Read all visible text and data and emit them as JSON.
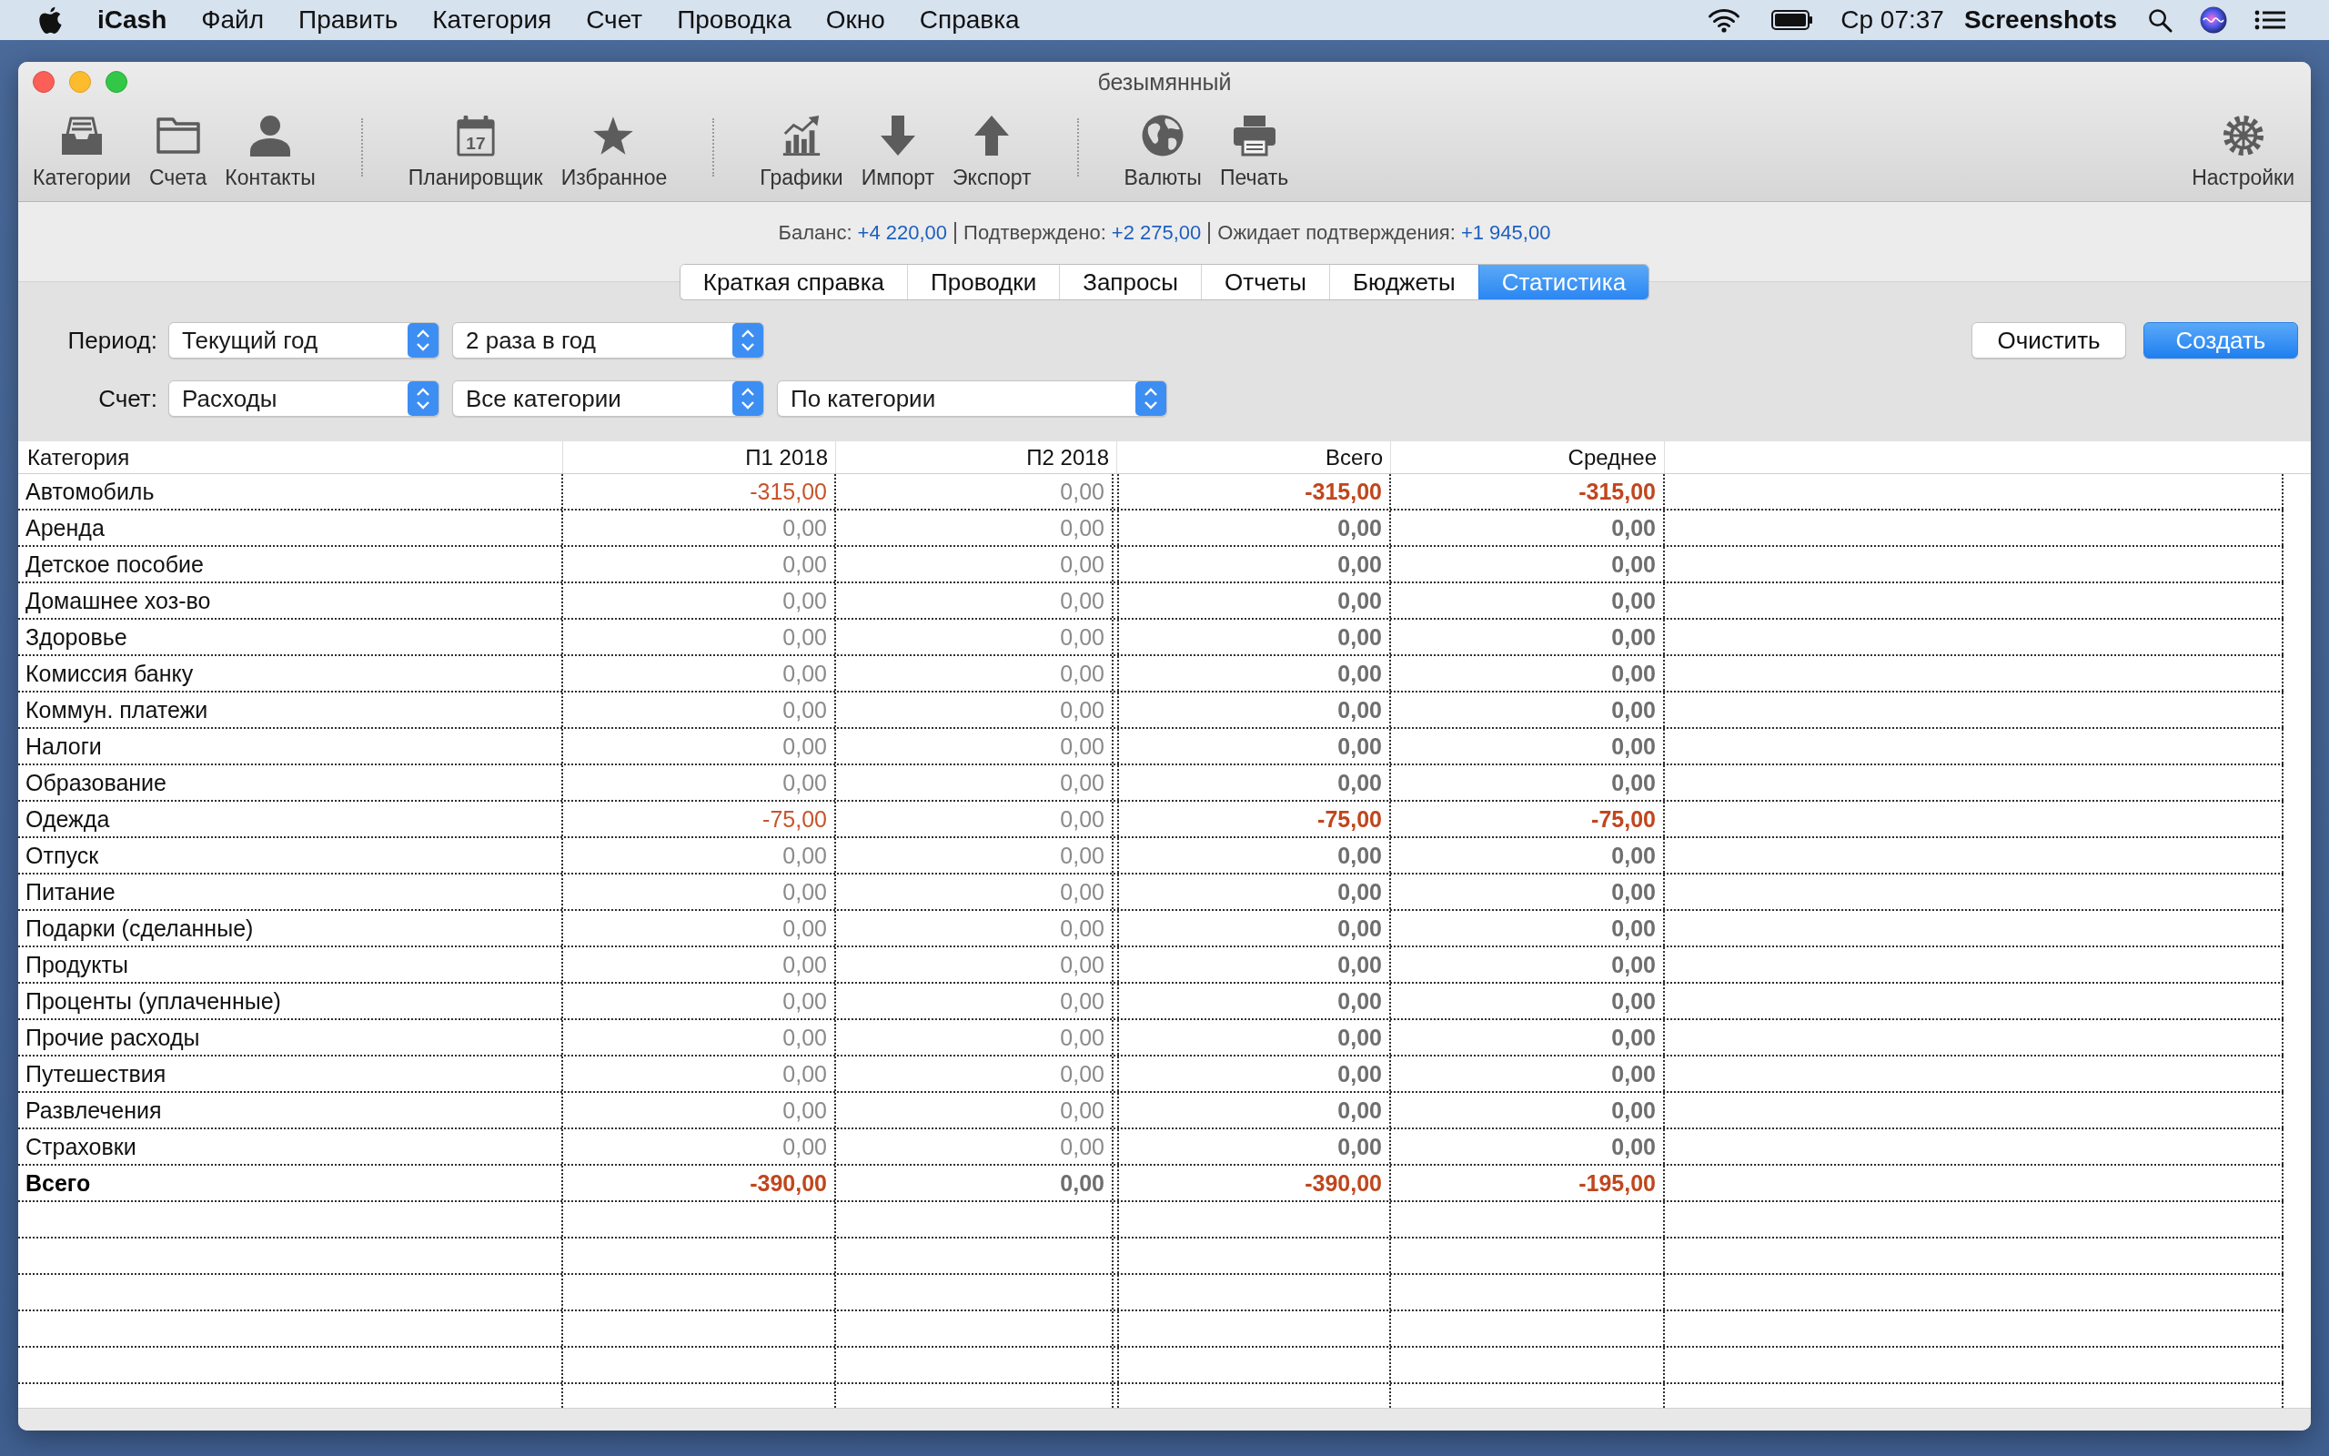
{
  "menu_bar": {
    "app": "iCash",
    "menus": [
      "Файл",
      "Править",
      "Категория",
      "Счет",
      "Проводка",
      "Окно",
      "Справка"
    ],
    "clock": "Ср 07:37",
    "user": "Screenshots"
  },
  "window": {
    "title": "безымянный"
  },
  "toolbar": {
    "groups": [
      [
        {
          "kind": "categories",
          "label": "Категории"
        },
        {
          "kind": "accounts",
          "label": "Счета"
        },
        {
          "kind": "contacts",
          "label": "Контакты"
        }
      ],
      [
        {
          "kind": "scheduler",
          "label": "Планировщик",
          "day": "17"
        },
        {
          "kind": "favorites",
          "label": "Избранное"
        }
      ],
      [
        {
          "kind": "charts",
          "label": "Графики"
        },
        {
          "kind": "import",
          "label": "Импорт"
        },
        {
          "kind": "export",
          "label": "Экспорт"
        }
      ],
      [
        {
          "kind": "currencies",
          "label": "Валюты"
        },
        {
          "kind": "print",
          "label": "Печать"
        }
      ]
    ],
    "trailing": [
      {
        "kind": "settings",
        "label": "Настройки"
      }
    ]
  },
  "summary": [
    {
      "label": "Баланс:",
      "value": "+4 220,00"
    },
    {
      "label": "Подтверждено:",
      "value": "+2 275,00"
    },
    {
      "label": "Ожидает подтверждения:",
      "value": "+1 945,00"
    }
  ],
  "tabs": [
    {
      "label": "Краткая справка",
      "selected": false
    },
    {
      "label": "Проводки",
      "selected": false
    },
    {
      "label": "Запросы",
      "selected": false
    },
    {
      "label": "Отчеты",
      "selected": false
    },
    {
      "label": "Бюджеты",
      "selected": false
    },
    {
      "label": "Статистика",
      "selected": true
    }
  ],
  "filters": [
    {
      "label": "Период:",
      "popups": [
        "Текущий год",
        "2 раза в год"
      ]
    },
    {
      "label": "Счет:",
      "popups": [
        "Расходы",
        "Все категории",
        "По категории"
      ]
    }
  ],
  "buttons": [
    {
      "label": "Очистить",
      "primary": false
    },
    {
      "label": "Создать",
      "primary": true
    }
  ],
  "table": {
    "columns": [
      {
        "label": "Категория",
        "kind": "name"
      },
      {
        "label": "П1 2018",
        "kind": "period"
      },
      {
        "label": "П2 2018",
        "kind": "period"
      },
      {
        "label": "Всего",
        "kind": "summary"
      },
      {
        "label": "Среднее",
        "kind": "summary"
      }
    ],
    "rows": [
      {
        "kind": "category",
        "cells": [
          {
            "value": "Автомобиль"
          },
          {
            "value": "-315,00",
            "negative": true
          },
          {
            "value": "0,00",
            "negative": false
          },
          {
            "value": "-315,00",
            "negative": true
          },
          {
            "value": "-315,00",
            "negative": true
          }
        ]
      },
      {
        "kind": "category",
        "cells": [
          {
            "value": "Аренда"
          },
          {
            "value": "0,00",
            "negative": false
          },
          {
            "value": "0,00",
            "negative": false
          },
          {
            "value": "0,00",
            "negative": false
          },
          {
            "value": "0,00",
            "negative": false
          }
        ]
      },
      {
        "kind": "category",
        "cells": [
          {
            "value": "Детское пособие"
          },
          {
            "value": "0,00",
            "negative": false
          },
          {
            "value": "0,00",
            "negative": false
          },
          {
            "value": "0,00",
            "negative": false
          },
          {
            "value": "0,00",
            "negative": false
          }
        ]
      },
      {
        "kind": "category",
        "cells": [
          {
            "value": "Домашнее хоз-во"
          },
          {
            "value": "0,00",
            "negative": false
          },
          {
            "value": "0,00",
            "negative": false
          },
          {
            "value": "0,00",
            "negative": false
          },
          {
            "value": "0,00",
            "negative": false
          }
        ]
      },
      {
        "kind": "category",
        "cells": [
          {
            "value": "Здоровье"
          },
          {
            "value": "0,00",
            "negative": false
          },
          {
            "value": "0,00",
            "negative": false
          },
          {
            "value": "0,00",
            "negative": false
          },
          {
            "value": "0,00",
            "negative": false
          }
        ]
      },
      {
        "kind": "category",
        "cells": [
          {
            "value": "Комиссия банку"
          },
          {
            "value": "0,00",
            "negative": false
          },
          {
            "value": "0,00",
            "negative": false
          },
          {
            "value": "0,00",
            "negative": false
          },
          {
            "value": "0,00",
            "negative": false
          }
        ]
      },
      {
        "kind": "category",
        "cells": [
          {
            "value": "Коммун. платежи"
          },
          {
            "value": "0,00",
            "negative": false
          },
          {
            "value": "0,00",
            "negative": false
          },
          {
            "value": "0,00",
            "negative": false
          },
          {
            "value": "0,00",
            "negative": false
          }
        ]
      },
      {
        "kind": "category",
        "cells": [
          {
            "value": "Налоги"
          },
          {
            "value": "0,00",
            "negative": false
          },
          {
            "value": "0,00",
            "negative": false
          },
          {
            "value": "0,00",
            "negative": false
          },
          {
            "value": "0,00",
            "negative": false
          }
        ]
      },
      {
        "kind": "category",
        "cells": [
          {
            "value": "Образование"
          },
          {
            "value": "0,00",
            "negative": false
          },
          {
            "value": "0,00",
            "negative": false
          },
          {
            "value": "0,00",
            "negative": false
          },
          {
            "value": "0,00",
            "negative": false
          }
        ]
      },
      {
        "kind": "category",
        "cells": [
          {
            "value": "Одежда"
          },
          {
            "value": "-75,00",
            "negative": true
          },
          {
            "value": "0,00",
            "negative": false
          },
          {
            "value": "-75,00",
            "negative": true
          },
          {
            "value": "-75,00",
            "negative": true
          }
        ]
      },
      {
        "kind": "category",
        "cells": [
          {
            "value": "Отпуск"
          },
          {
            "value": "0,00",
            "negative": false
          },
          {
            "value": "0,00",
            "negative": false
          },
          {
            "value": "0,00",
            "negative": false
          },
          {
            "value": "0,00",
            "negative": false
          }
        ]
      },
      {
        "kind": "category",
        "cells": [
          {
            "value": "Питание"
          },
          {
            "value": "0,00",
            "negative": false
          },
          {
            "value": "0,00",
            "negative": false
          },
          {
            "value": "0,00",
            "negative": false
          },
          {
            "value": "0,00",
            "negative": false
          }
        ]
      },
      {
        "kind": "category",
        "cells": [
          {
            "value": "Подарки (сделанные)"
          },
          {
            "value": "0,00",
            "negative": false
          },
          {
            "value": "0,00",
            "negative": false
          },
          {
            "value": "0,00",
            "negative": false
          },
          {
            "value": "0,00",
            "negative": false
          }
        ]
      },
      {
        "kind": "category",
        "cells": [
          {
            "value": "Продукты"
          },
          {
            "value": "0,00",
            "negative": false
          },
          {
            "value": "0,00",
            "negative": false
          },
          {
            "value": "0,00",
            "negative": false
          },
          {
            "value": "0,00",
            "negative": false
          }
        ]
      },
      {
        "kind": "category",
        "cells": [
          {
            "value": "Проценты (уплаченные)"
          },
          {
            "value": "0,00",
            "negative": false
          },
          {
            "value": "0,00",
            "negative": false
          },
          {
            "value": "0,00",
            "negative": false
          },
          {
            "value": "0,00",
            "negative": false
          }
        ]
      },
      {
        "kind": "category",
        "cells": [
          {
            "value": "Прочие расходы"
          },
          {
            "value": "0,00",
            "negative": false
          },
          {
            "value": "0,00",
            "negative": false
          },
          {
            "value": "0,00",
            "negative": false
          },
          {
            "value": "0,00",
            "negative": false
          }
        ]
      },
      {
        "kind": "category",
        "cells": [
          {
            "value": "Путешествия"
          },
          {
            "value": "0,00",
            "negative": false
          },
          {
            "value": "0,00",
            "negative": false
          },
          {
            "value": "0,00",
            "negative": false
          },
          {
            "value": "0,00",
            "negative": false
          }
        ]
      },
      {
        "kind": "category",
        "cells": [
          {
            "value": "Развлечения"
          },
          {
            "value": "0,00",
            "negative": false
          },
          {
            "value": "0,00",
            "negative": false
          },
          {
            "value": "0,00",
            "negative": false
          },
          {
            "value": "0,00",
            "negative": false
          }
        ]
      },
      {
        "kind": "category",
        "cells": [
          {
            "value": "Страховки"
          },
          {
            "value": "0,00",
            "negative": false
          },
          {
            "value": "0,00",
            "negative": false
          },
          {
            "value": "0,00",
            "negative": false
          },
          {
            "value": "0,00",
            "negative": false
          }
        ]
      },
      {
        "kind": "total",
        "cells": [
          {
            "value": "Всего"
          },
          {
            "value": "-390,00",
            "negative": true
          },
          {
            "value": "0,00",
            "negative": false
          },
          {
            "value": "-390,00",
            "negative": true
          },
          {
            "value": "-195,00",
            "negative": true
          }
        ]
      }
    ]
  }
}
